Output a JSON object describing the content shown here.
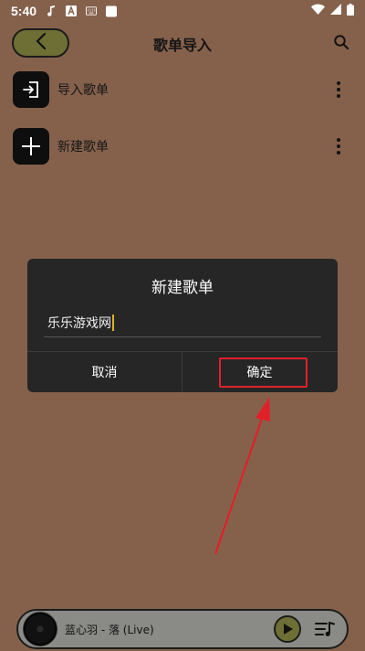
{
  "status_bar": {
    "time": "5:40",
    "icons": [
      "music-note-icon",
      "a-notification-icon",
      "keyboard-icon",
      "square-icon"
    ],
    "right_icons": [
      "wifi-icon",
      "signal-icon",
      "battery-icon"
    ]
  },
  "header": {
    "title": "歌单导入",
    "back_icon": "chevron-left-icon",
    "search_icon": "search-icon"
  },
  "list": {
    "items": [
      {
        "label": "导入歌单",
        "icon": "import-icon"
      },
      {
        "label": "新建歌单",
        "icon": "plus-icon"
      }
    ]
  },
  "dialog": {
    "title": "新建歌单",
    "input_value": "乐乐游戏网",
    "cancel_label": "取消",
    "confirm_label": "确定"
  },
  "player": {
    "song_title": "蓝心羽 - 落 (Live)",
    "play_icon": "play-icon",
    "queue_icon": "playlist-icon"
  },
  "colors": {
    "background": "#85614C",
    "accent": "#6E6F35",
    "dialog_bg": "#262626",
    "highlight": "#E0212A"
  }
}
